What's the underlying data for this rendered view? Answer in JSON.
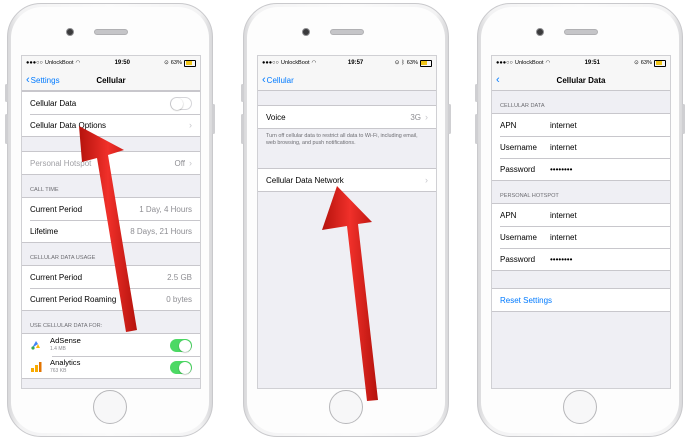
{
  "status_bar": {
    "carrier": "UnlockBoot",
    "battery": "63%"
  },
  "phone1": {
    "time": "19:50",
    "back_label": "Settings",
    "title": "Cellular",
    "cellular_data_label": "Cellular Data",
    "cellular_data_options_label": "Cellular Data Options",
    "personal_hotspot_label": "Personal Hotspot",
    "personal_hotspot_value": "Off",
    "call_time_header": "CALL TIME",
    "current_period_label": "Current Period",
    "current_period_value": "1 Day, 4 Hours",
    "lifetime_label": "Lifetime",
    "lifetime_value": "8 Days, 21 Hours",
    "usage_header": "CELLULAR DATA USAGE",
    "usage_current_label": "Current Period",
    "usage_current_value": "2.5 GB",
    "usage_roaming_label": "Current Period Roaming",
    "usage_roaming_value": "0 bytes",
    "apps_header": "USE CELLULAR DATA FOR:",
    "apps": [
      {
        "name": "AdSense",
        "size": "1.4 MB"
      },
      {
        "name": "Analytics",
        "size": "763 KB"
      }
    ]
  },
  "phone2": {
    "time": "19:57",
    "back_label": "Cellular",
    "voice_label": "Voice",
    "voice_value": "3G",
    "note": "Turn off cellular data to restrict all data to Wi-Fi, including email, web browsing, and push notifications.",
    "network_label": "Cellular Data Network"
  },
  "phone3": {
    "time": "19:51",
    "title": "Cellular Data",
    "cellular_header": "CELLULAR DATA",
    "hotspot_header": "PERSONAL HOTSPOT",
    "apn_label": "APN",
    "username_label": "Username",
    "password_label": "Password",
    "apn_value": "internet",
    "username_value": "internet",
    "password_value": "••••••••",
    "reset_label": "Reset Settings"
  },
  "colors": {
    "accent": "#007aff",
    "toggle_on": "#4cd964",
    "arrow": "#e8231b"
  },
  "icons": [
    "wifi-icon",
    "lock-icon",
    "bluetooth-icon",
    "battery-icon",
    "chevron-left-icon",
    "chevron-right-icon",
    "adsense-icon",
    "analytics-icon",
    "red-arrow"
  ]
}
